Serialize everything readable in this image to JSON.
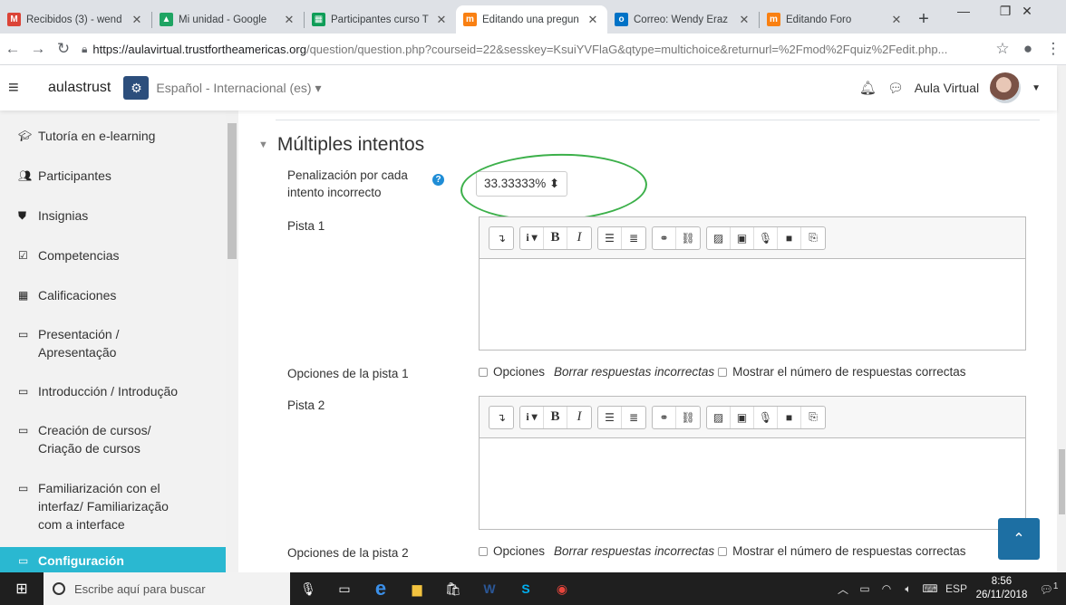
{
  "browser": {
    "tabs": [
      {
        "title": "Recibidos (3) - wend",
        "favicon": "M",
        "color": "#db4437",
        "active": false
      },
      {
        "title": "Mi unidad - Google",
        "favicon": "▲",
        "color": "#1fa463",
        "active": false
      },
      {
        "title": "Participantes curso T",
        "favicon": "▦",
        "color": "#0f9d58",
        "active": false
      },
      {
        "title": "Editando una pregun",
        "favicon": "m",
        "color": "#f98012",
        "active": true
      },
      {
        "title": "Correo: Wendy Eraz",
        "favicon": "o",
        "color": "#0072c6",
        "active": false
      },
      {
        "title": "Editando Foro",
        "favicon": "m",
        "color": "#f98012",
        "active": false
      }
    ],
    "new_tab_label": "+",
    "url_host": "https://aulavirtual.trustfortheamericas.org",
    "url_path": "/question/question.php?courseid=22&sesskey=KsuiYVFlaG&qtype=multichoice&returnurl=%2Fmod%2Fquiz%2Fedit.php..."
  },
  "navbar": {
    "brand": "aulastrust",
    "language": "Español - Internacional (es) ▾",
    "user_name": "Aula Virtual"
  },
  "sidebar": {
    "items": [
      {
        "label": "Tutoría en e-learning",
        "icon": "graduation-cap-icon",
        "glyph": "🎓︎"
      },
      {
        "label": "Participantes",
        "icon": "users-icon",
        "glyph": "👥︎"
      },
      {
        "label": "Insignias",
        "icon": "shield-icon",
        "glyph": "⛊"
      },
      {
        "label": "Competencias",
        "icon": "checkbox-icon",
        "glyph": "☑"
      },
      {
        "label": "Calificaciones",
        "icon": "table-icon",
        "glyph": "▦"
      },
      {
        "label": "Presentación /\nApresentação",
        "icon": "folder-icon",
        "glyph": "▭"
      },
      {
        "label": "Introducción / Introdução",
        "icon": "folder-icon",
        "glyph": "▭"
      },
      {
        "label": "Creación de cursos/\nCriação de cursos",
        "icon": "folder-icon",
        "glyph": "▭"
      },
      {
        "label": "Familiarización con el\ninterfaz/ Familiarização\ncom a interface",
        "icon": "folder-icon",
        "glyph": "▭"
      },
      {
        "label": "Configuración",
        "icon": "folder-icon",
        "glyph": "▭",
        "selected": true
      }
    ]
  },
  "form": {
    "section_title": "Múltiples intentos",
    "penalty_label": "Penalización por cada\nintento incorrecto",
    "penalty_value": "33.33333% ⬍",
    "hint1_label": "Pista 1",
    "hint2_label": "Pista 2",
    "hint1_options_label": "Opciones de la pista 1",
    "hint2_options_label": "Opciones de la pista 2",
    "opt_options": "Opciones",
    "opt_clear_wrong": "Borrar respuestas incorrectas",
    "opt_show_correct": "Mostrar el número de respuestas correctas",
    "toolbar": {
      "collapse": "↴",
      "style": "i ▾",
      "bold": "B",
      "italic": "I",
      "ul": "☰",
      "ol": "≣",
      "link": "⚭",
      "unlink": "⛓",
      "image": "▨",
      "media": "▣",
      "mic": "🎙︎",
      "video": "■",
      "copy": "⎘"
    }
  },
  "taskbar": {
    "search_placeholder": "Escribe aquí para buscar",
    "lang": "ESP",
    "time": "8:56",
    "date": "26/11/2018",
    "notifications": "1"
  }
}
